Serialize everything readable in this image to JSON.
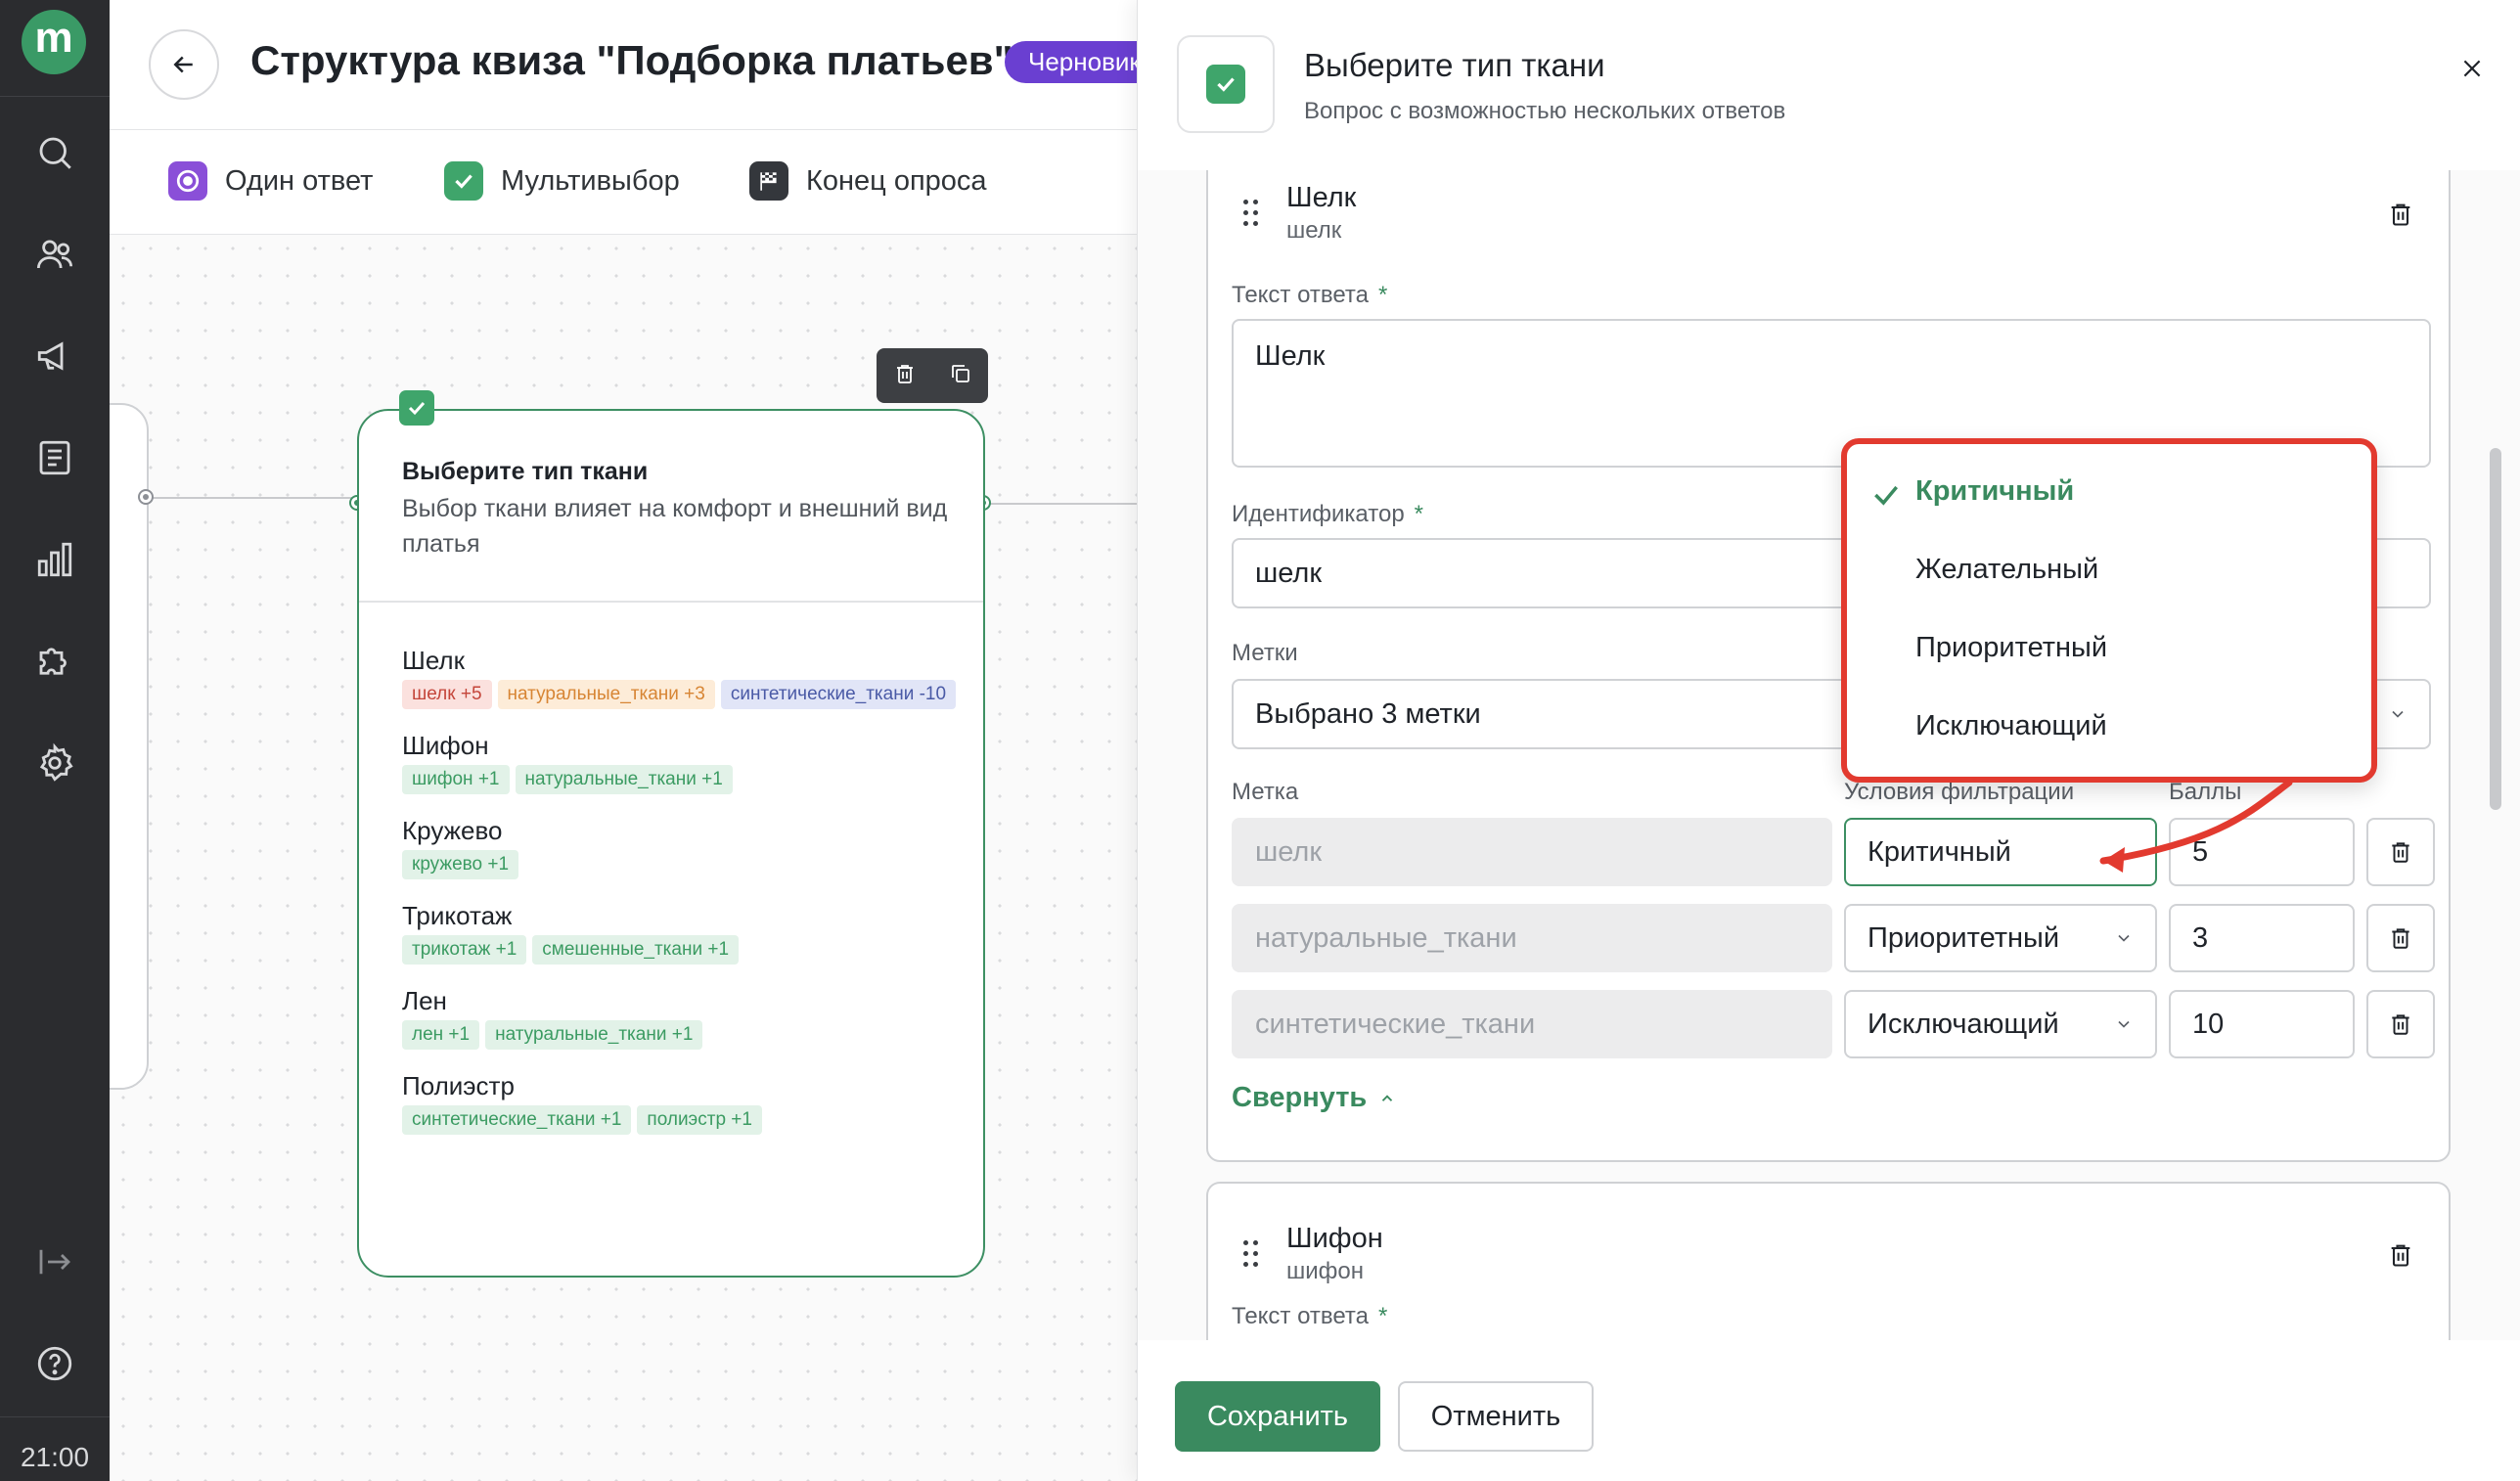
{
  "sidebar": {
    "logo_letter": "m",
    "items": [
      {
        "icon": "search-icon"
      },
      {
        "icon": "users-icon"
      },
      {
        "icon": "megaphone-icon"
      },
      {
        "icon": "document-icon"
      },
      {
        "icon": "analytics-icon"
      },
      {
        "icon": "puzzle-icon"
      },
      {
        "icon": "settings-icon"
      }
    ],
    "bottom_items": [
      {
        "icon": "logout-icon"
      },
      {
        "icon": "help-icon"
      }
    ],
    "time": "21:00"
  },
  "header": {
    "title": "Структура квиза \"Подборка платьев\"",
    "status_badge": "Черновик"
  },
  "toolbar": {
    "single_answer": "Один ответ",
    "multi_select": "Мультивыбор",
    "end_survey": "Конец опроса"
  },
  "node": {
    "title": "Выберите тип ткани",
    "description": "Выбор ткани влияет на комфорт и внешний вид платья",
    "items": [
      {
        "name": "Шелк",
        "tags": [
          {
            "text": "шелк +5",
            "color": "red"
          },
          {
            "text": "натуральные_ткани +3",
            "color": "orange"
          },
          {
            "text": "синтетические_ткани -10",
            "color": "blue"
          }
        ]
      },
      {
        "name": "Шифон",
        "tags": [
          {
            "text": "шифон +1",
            "color": "green"
          },
          {
            "text": "натуральные_ткани +1",
            "color": "green"
          }
        ]
      },
      {
        "name": "Кружево",
        "tags": [
          {
            "text": "кружево +1",
            "color": "green"
          }
        ]
      },
      {
        "name": "Трикотаж",
        "tags": [
          {
            "text": "трикотаж +1",
            "color": "green"
          },
          {
            "text": "смешенные_ткани +1",
            "color": "green"
          }
        ]
      },
      {
        "name": "Лен",
        "tags": [
          {
            "text": "лен +1",
            "color": "green"
          },
          {
            "text": "натуральные_ткани +1",
            "color": "green"
          }
        ]
      },
      {
        "name": "Полиэстр",
        "tags": [
          {
            "text": "синтетические_ткани +1",
            "color": "green"
          },
          {
            "text": "полиэстр +1",
            "color": "green"
          }
        ]
      }
    ]
  },
  "panel": {
    "title": "Выберите тип ткани",
    "subtitle": "Вопрос с возможностью нескольких ответов",
    "answer1": {
      "name": "Шелк",
      "id_small": "шелк",
      "text_label": "Текст ответа",
      "text_value": "Шелк",
      "id_label": "Идентификатор",
      "id_value": "шелк",
      "tags_label": "Метки",
      "tags_value": "Выбрано 3 метки",
      "col_tag": "Метка",
      "col_cond": "Условия фильтрации",
      "col_score": "Баллы",
      "rows": [
        {
          "tag": "шелк",
          "condition": "Критичный",
          "score": "5"
        },
        {
          "tag": "натуральные_ткани",
          "condition": "Приоритетный",
          "score": "3"
        },
        {
          "tag": "синтетические_ткани",
          "condition": "Исключающий",
          "score": "10"
        }
      ],
      "collapse": "Свернуть"
    },
    "answer2": {
      "name": "Шифон",
      "id_small": "шифон",
      "text_label": "Текст ответа"
    },
    "required_mark": "*"
  },
  "dropdown": {
    "options": [
      "Критичный",
      "Желательный",
      "Приоритетный",
      "Исключающий"
    ],
    "selected": "Критичный"
  },
  "footer": {
    "save": "Сохранить",
    "cancel": "Отменить"
  },
  "colors": {
    "accent": "#3a8a5f",
    "badge": "#6a3fd1",
    "annotation": "#e23a2f",
    "sidebar": "#2b2c2f"
  }
}
